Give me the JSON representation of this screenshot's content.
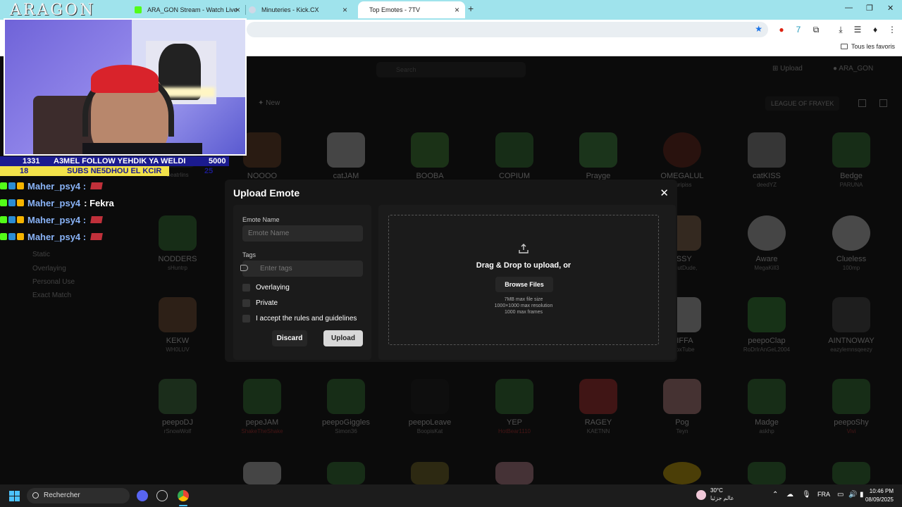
{
  "browser": {
    "tabs": [
      {
        "title": "ARA_GON Stream - Watch Live"
      },
      {
        "title": "Minuteries - Kick.CX"
      },
      {
        "title": "Top Emotes - 7TV"
      }
    ],
    "bookmarks_all": "Tous les favoris"
  },
  "page": {
    "search_placeholder": "Search",
    "upload_label": "Upload",
    "user_name": "ARA_GON",
    "new_label": "New",
    "league_label": "LEAGUE OF FRAYEK",
    "filters": [
      "Static",
      "Overlaying",
      "Personal Use",
      "Exact Match"
    ],
    "emotes": [
      {
        "name": "",
        "author": "Beatrlins"
      },
      {
        "name": "NOOOO",
        "author": ""
      },
      {
        "name": "catJAM",
        "author": ""
      },
      {
        "name": "BOOBA",
        "author": ""
      },
      {
        "name": "COPIUM",
        "author": ""
      },
      {
        "name": "Prayge",
        "author": ""
      },
      {
        "name": "OMEGALUL",
        "author": "curipiss"
      },
      {
        "name": "catKISS",
        "author": "deedYZ"
      },
      {
        "name": "Bedge",
        "author": "PARUNA"
      },
      {
        "name": "NODDERS",
        "author": "sHuntrp"
      },
      {
        "name": "JSSY",
        "author": "DonutDude,"
      },
      {
        "name": "Aware",
        "author": "MegaKill3"
      },
      {
        "name": "Clueless",
        "author": "100mp"
      },
      {
        "name": "KEKW",
        "author": "WH0LUV"
      },
      {
        "name": "NIFFA",
        "author": "ohoxTube"
      },
      {
        "name": "peepoClap",
        "author": "RoDrIrAnGeL2004"
      },
      {
        "name": "AINTNOWAY",
        "author": "eazylemnsqeezy"
      },
      {
        "name": "peepoDJ",
        "author": "rSnowWolf"
      },
      {
        "name": "pepeJAM",
        "author": "ShakeTheShake"
      },
      {
        "name": "peepoGiggles",
        "author": "Simon36"
      },
      {
        "name": "peepoLeave",
        "author": "BoopisKat"
      },
      {
        "name": "YEP",
        "author": "HotBear1110"
      },
      {
        "name": "RAGEY",
        "author": "KAETNN"
      },
      {
        "name": "Pog",
        "author": "Teyn"
      },
      {
        "name": "Madge",
        "author": "askhp"
      },
      {
        "name": "peepoShy",
        "author": "Vivi"
      }
    ]
  },
  "modal": {
    "title": "Upload Emote",
    "name_label": "Emote Name",
    "name_placeholder": "Emote Name",
    "tags_label": "Tags",
    "tags_placeholder": "Enter tags",
    "checkboxes": [
      "Overlaying",
      "Private",
      "I accept the rules and guidelines"
    ],
    "discard_label": "Discard",
    "upload_label": "Upload",
    "drop_title": "Drag & Drop to upload, or",
    "browse_label": "Browse Files",
    "info": [
      "7MB max file size",
      "1000×1000 max resolution",
      "1000 max frames"
    ]
  },
  "stream": {
    "logo": "ARAGON",
    "ticker1": {
      "left": "1331",
      "text": "A3MEL FOLLOW YEHDIK YA WELDI",
      "right": "5000"
    },
    "ticker2": {
      "left": "18",
      "text": "SUBS NE5DHOU EL KCIR",
      "right": "25"
    },
    "chat": [
      {
        "user": "Maher_psy4 :",
        "msg": "",
        "emote": true
      },
      {
        "user": "Maher_psy4",
        "msg": ": Fekra",
        "emote": false
      },
      {
        "user": "Maher_psy4 :",
        "msg": "",
        "emote": true
      },
      {
        "user": "Maher_psy4 :",
        "msg": "",
        "emote": true
      }
    ]
  },
  "taskbar": {
    "search_label": "Rechercher",
    "weather_temp": "30°C",
    "weather_desc": "عالم جزئيا",
    "lang": "FRA",
    "time": "10:46 PM",
    "date": "08/09/2025"
  },
  "colors": {
    "accent_green": "#53fc18",
    "tabbar": "#9fe3ec",
    "modal_bg": "#161616"
  }
}
